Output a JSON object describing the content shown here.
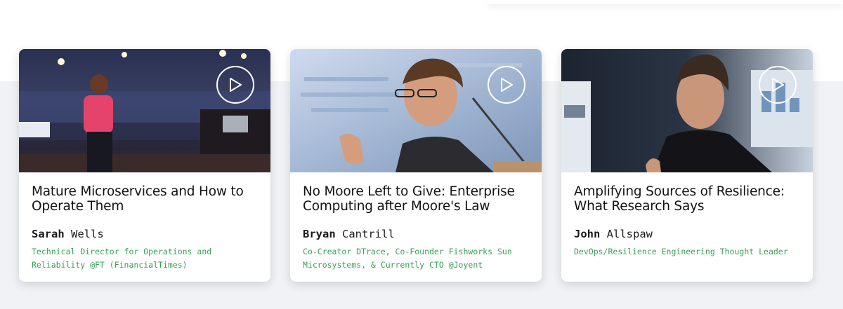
{
  "talks": [
    {
      "title": "Mature Microservices and How to Operate Them",
      "speaker_first": "Sarah",
      "speaker_last": "Wells",
      "role": "Technical Director for Operations and Reliability @FT (FinancialTimes)",
      "play_icon": "play-circle-icon"
    },
    {
      "title": "No Moore Left to Give: Enterprise Computing after Moore's Law",
      "speaker_first": "Bryan",
      "speaker_last": "Cantrill",
      "role": "Co-Creator DTrace, Co-Founder Fishworks Sun Microsystems, & Currently CTO @Joyent",
      "play_icon": "play-circle-icon"
    },
    {
      "title": "Amplifying Sources of Resilience: What Research Says",
      "speaker_first": "John",
      "speaker_last": "Allspaw",
      "role": "DevOps/Resilience Engineering Thought Leader",
      "play_icon": "play-circle-icon"
    }
  ],
  "colors": {
    "role_text": "#3a9e58",
    "title_text": "#121212",
    "band_background": "#f0f2f5"
  }
}
